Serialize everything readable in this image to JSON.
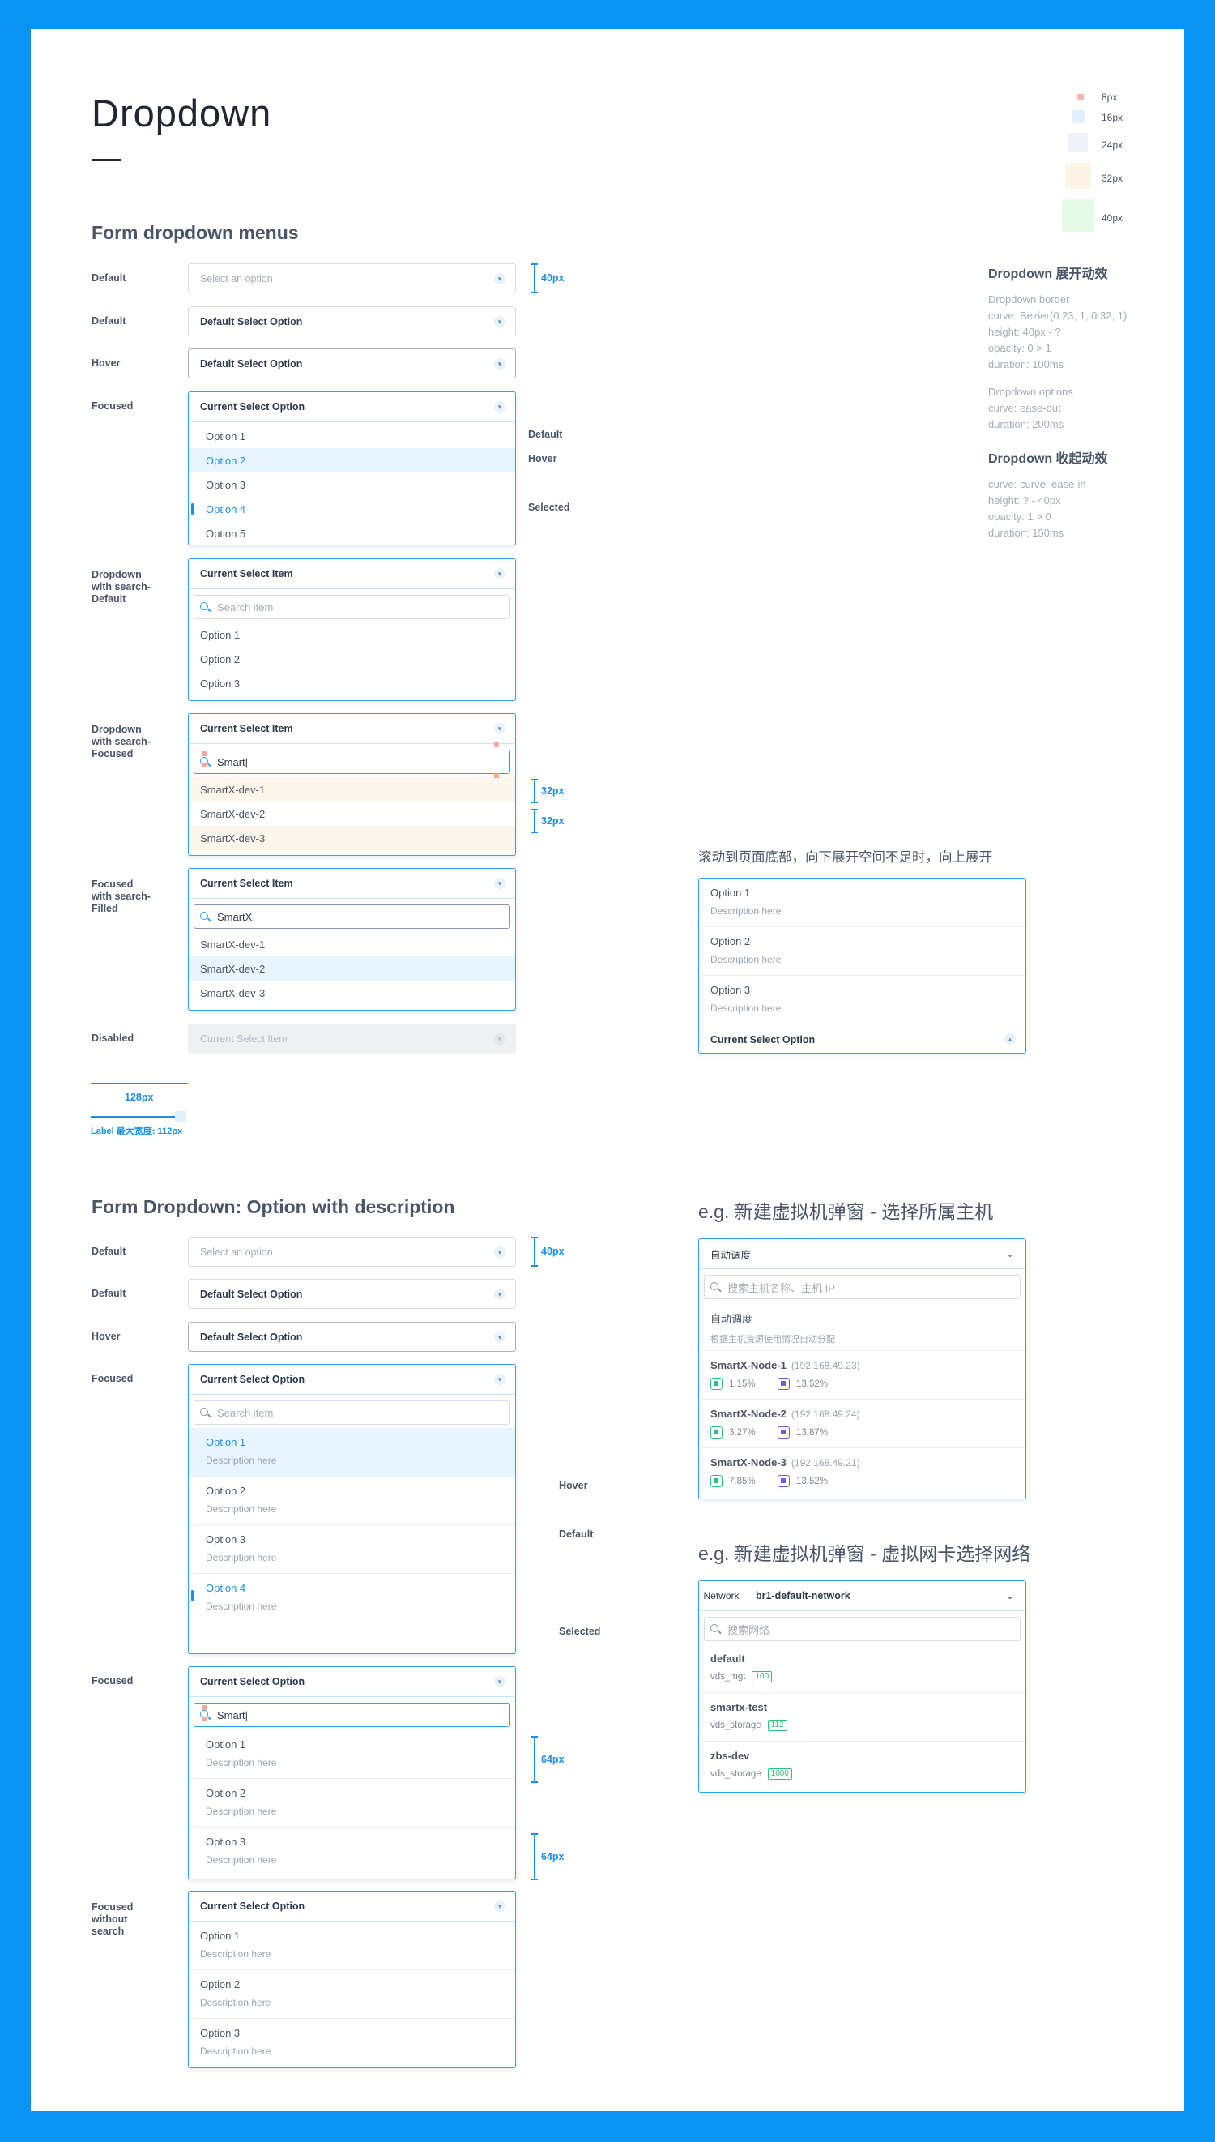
{
  "page": {
    "title": "Dropdown",
    "section1_title": "Form dropdown menus",
    "section2_title": "Form Dropdown: Option with description",
    "example1_title": "e.g. 新建虚拟机弹窗 - 选择所属主机",
    "example2_title": "e.g. 新建虚拟机弹窗 - 虚拟网卡选择网络"
  },
  "legend": [
    "8px",
    "16px",
    "24px",
    "32px",
    "40px"
  ],
  "legend_colors": [
    "#f9b4ad",
    "#dff0fd",
    "#f1f2f9",
    "#fdf3e6",
    "#e6fae8"
  ],
  "notes": {
    "expand_title": "Dropdown 展开动效",
    "expand_lines": [
      "Dropdown border",
      "curve: Bezier(0.23, 1, 0.32, 1)",
      "height: 40px - ?",
      "opacity: 0 > 1",
      "duration: 100ms"
    ],
    "options_lines": [
      "Dropdown options",
      "curve: ease-out",
      "duration: 200ms"
    ],
    "collapse_title": "Dropdown 收起动效",
    "collapse_lines": [
      "curve: curve: ease-in",
      "height: ? - 40px",
      "opacity: 1 > 0",
      "duration: 150ms"
    ]
  },
  "labels": {
    "default": "Default",
    "hover": "Hover",
    "focused": "Focused",
    "selected": "Selected",
    "search_default": "Dropdown\nwith search-\nDefault",
    "search_focused": "Dropdown\nwith search-\nFocused",
    "search_filled": "Focused\nwith search-\nFilled",
    "disabled": "Disabled",
    "without_search": "Focused\nwithout\nsearch"
  },
  "fields": {
    "placeholder": "Select an option",
    "default_value": "Default Select Option",
    "current_option": "Current Select Option",
    "current_item": "Current Select Item"
  },
  "options": [
    "Option 1",
    "Option 2",
    "Option 3",
    "Option 4",
    "Option 5"
  ],
  "search": {
    "placeholder": "Search item",
    "typed": "Smart",
    "filled": "SmartX"
  },
  "smartx_options": [
    "SmartX-dev-1",
    "SmartX-dev-2",
    "SmartX-dev-3"
  ],
  "description": "Description here",
  "measures": {
    "m40": "40px",
    "m32": "32px",
    "m64": "64px",
    "m128": "128px",
    "label_max": "Label 最大宽度: 112px"
  },
  "upward": {
    "note": "滚动到页面底部，向下展开空间不足时，向上展开",
    "current": "Current Select Option"
  },
  "host": {
    "value": "自动调度",
    "search_placeholder": "搜索主机名称、主机 IP",
    "auto_title": "自动调度",
    "auto_desc": "根据主机资源使用情况自动分配",
    "nodes": [
      {
        "name": "SmartX-Node-1",
        "ip": "(192.168.49.23)",
        "cpu": "1.15%",
        "mem": "13.52%"
      },
      {
        "name": "SmartX-Node-2",
        "ip": "(192.168.49.24)",
        "cpu": "3.27%",
        "mem": "13.87%"
      },
      {
        "name": "SmartX-Node-3",
        "ip": "(192.168.49.21)",
        "cpu": "7.85%",
        "mem": "13.52%"
      }
    ]
  },
  "network": {
    "label": "Network",
    "value": "br1-default-network",
    "search_placeholder": "搜索网络",
    "items": [
      {
        "name": "default",
        "sub": "vds_mgt",
        "vlan": "100"
      },
      {
        "name": "smartx-test",
        "sub": "vds_storage",
        "vlan": "112"
      },
      {
        "name": "zbs-dev",
        "sub": "vds_storage",
        "vlan": "1000"
      }
    ]
  },
  "colors": {
    "frame": "#0a93f5",
    "accent": "#1a8fe6",
    "focus_border": "#2fa0f2",
    "hover_bg": "#e9f5fe",
    "green": "#28c27a",
    "purple": "#6b5ce7"
  }
}
